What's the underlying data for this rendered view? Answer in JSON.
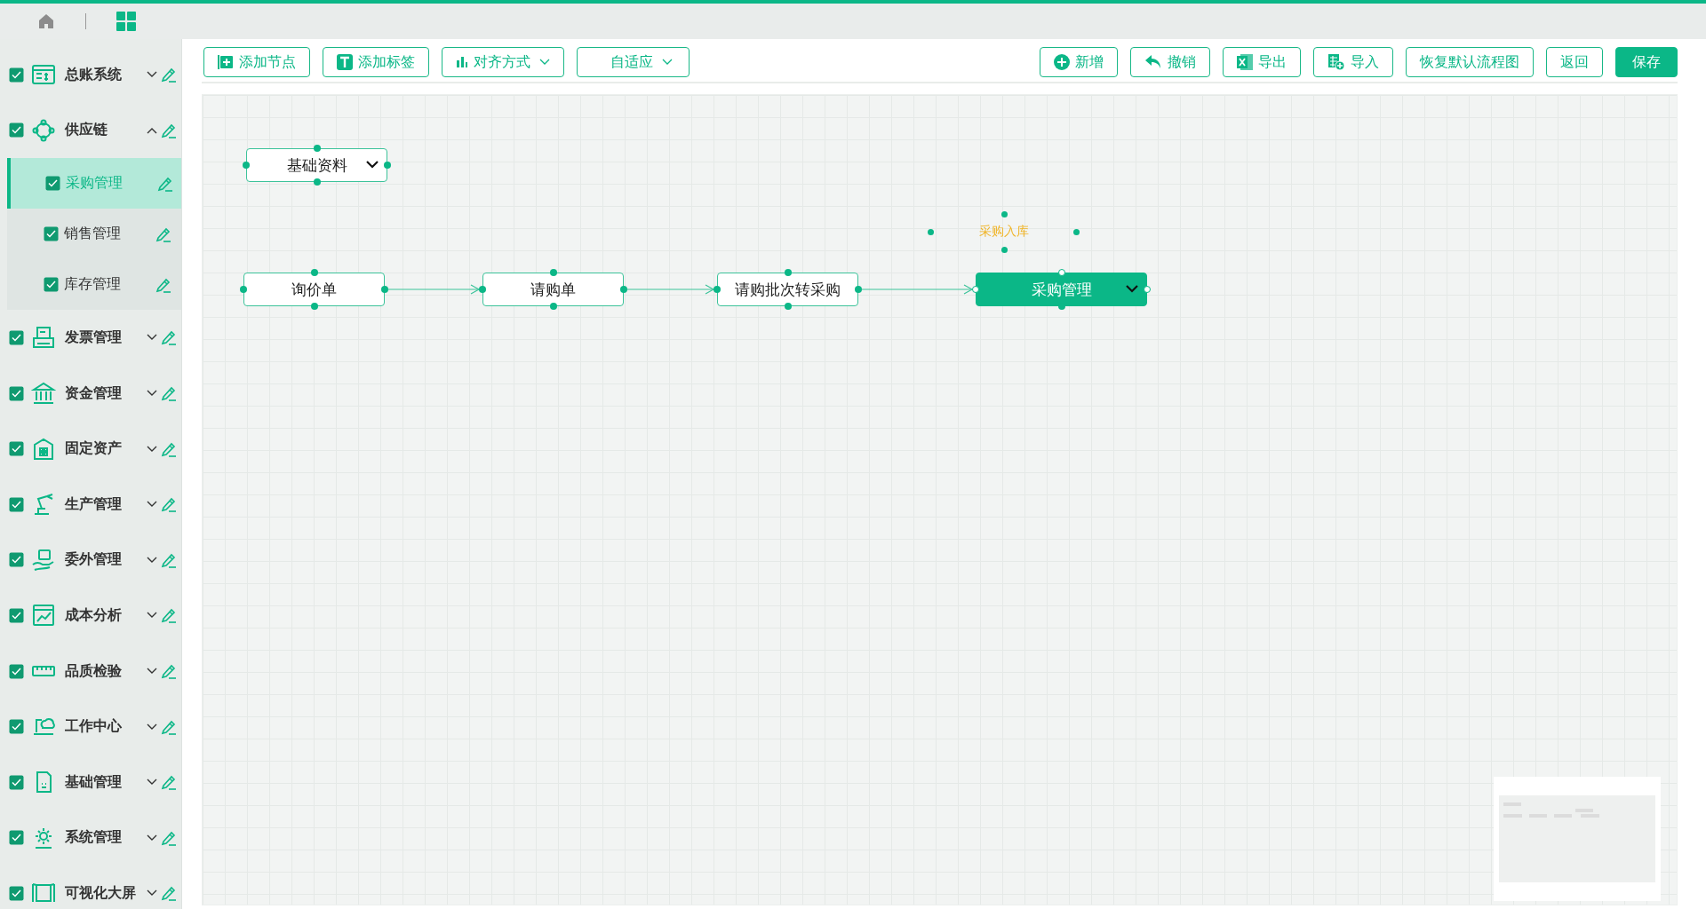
{
  "sidebar": {
    "items": [
      {
        "label": "总账系统",
        "checked": true,
        "expanded": false
      },
      {
        "label": "供应链",
        "checked": true,
        "expanded": true,
        "children": [
          {
            "label": "采购管理",
            "checked": true,
            "selected": true
          },
          {
            "label": "销售管理",
            "checked": true,
            "selected": false
          },
          {
            "label": "库存管理",
            "checked": true,
            "selected": false
          }
        ]
      },
      {
        "label": "发票管理",
        "checked": true,
        "expanded": false
      },
      {
        "label": "资金管理",
        "checked": true,
        "expanded": false
      },
      {
        "label": "固定资产",
        "checked": true,
        "expanded": false
      },
      {
        "label": "生产管理",
        "checked": true,
        "expanded": false
      },
      {
        "label": "委外管理",
        "checked": true,
        "expanded": false
      },
      {
        "label": "成本分析",
        "checked": true,
        "expanded": false
      },
      {
        "label": "品质检验",
        "checked": true,
        "expanded": false
      },
      {
        "label": "工作中心",
        "checked": true,
        "expanded": false
      },
      {
        "label": "基础管理",
        "checked": true,
        "expanded": false
      },
      {
        "label": "系统管理",
        "checked": true,
        "expanded": false
      },
      {
        "label": "可视化大屏",
        "checked": true,
        "expanded": false
      }
    ]
  },
  "toolbar": {
    "left": [
      {
        "label": "添加节点",
        "kind": "add-node"
      },
      {
        "label": "添加标签",
        "kind": "add-label"
      },
      {
        "label": "对齐方式",
        "kind": "align"
      },
      {
        "label": "自适应",
        "kind": "fit"
      }
    ],
    "right": [
      {
        "label": "新增",
        "kind": "add",
        "primary": false
      },
      {
        "label": "撤销",
        "kind": "undo",
        "primary": false
      },
      {
        "label": "导出",
        "kind": "export",
        "primary": false
      },
      {
        "label": "导入",
        "kind": "import",
        "primary": false
      },
      {
        "label": "恢复默认流程图",
        "kind": "plain",
        "primary": false
      },
      {
        "label": "返回",
        "kind": "plain",
        "primary": false
      },
      {
        "label": "保存",
        "kind": "plain",
        "primary": true
      }
    ]
  },
  "canvas": {
    "free_nodes": [
      {
        "label": "基础资料",
        "selected": false,
        "dropdown": true
      }
    ],
    "flow": [
      {
        "label": "询价单",
        "selected": false,
        "dropdown": false
      },
      {
        "label": "请购单",
        "selected": false,
        "dropdown": false
      },
      {
        "label": "请购批次转采购",
        "selected": false,
        "dropdown": false
      },
      {
        "label": "采购管理",
        "selected": true,
        "dropdown": true
      }
    ],
    "tag": {
      "label": "采购入库"
    }
  }
}
